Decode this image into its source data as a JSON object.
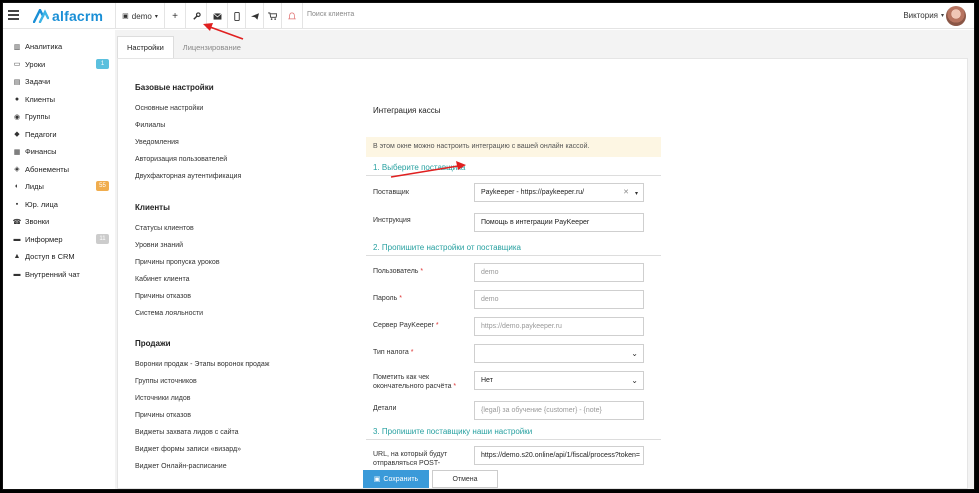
{
  "topbar": {
    "logo_text": "alfacrm",
    "branch": "demo",
    "search_placeholder": "Поиск клиента",
    "user_name": "Виктория",
    "icons": [
      "plus-icon",
      "wrench-icon",
      "mail-icon",
      "phone-icon",
      "telegram-icon",
      "cart-icon",
      "bell-icon"
    ]
  },
  "sidebar": {
    "items": [
      {
        "label": "Аналитика",
        "icon": "analytics-icon"
      },
      {
        "label": "Уроки",
        "icon": "lessons-icon",
        "badge": "1",
        "badge_color": "#5bc0de"
      },
      {
        "label": "Задачи",
        "icon": "tasks-icon"
      },
      {
        "label": "Клиенты",
        "icon": "client-icon"
      },
      {
        "label": "Группы",
        "icon": "groups-icon"
      },
      {
        "label": "Педагоги",
        "icon": "teacher-icon"
      },
      {
        "label": "Финансы",
        "icon": "finance-icon"
      },
      {
        "label": "Абонементы",
        "icon": "subscription-icon"
      },
      {
        "label": "Лиды",
        "icon": "leads-icon",
        "badge": "55",
        "badge_color": "#f0ad4e"
      },
      {
        "label": "Юр. лица",
        "icon": "legal-icon"
      },
      {
        "label": "Звонки",
        "icon": "calls-icon"
      },
      {
        "label": "Информер",
        "icon": "informer-icon",
        "badge": "11",
        "badge_color": "#ccc"
      },
      {
        "label": "Доступ в CRM",
        "icon": "access-icon"
      },
      {
        "label": "Внутренний чат",
        "icon": "chat-icon"
      }
    ]
  },
  "tabs": [
    {
      "label": "Настройки",
      "active": true
    },
    {
      "label": "Лицензирование",
      "active": false
    }
  ],
  "settings_menu": {
    "basic": {
      "title": "Базовые настройки",
      "links": [
        "Основные настройки",
        "Филиалы",
        "Уведомления",
        "Авторизация пользователей",
        "Двухфакторная аутентификация"
      ]
    },
    "clients": {
      "title": "Клиенты",
      "links": [
        "Статусы клиентов",
        "Уровни знаний",
        "Причины пропуска уроков",
        "Кабинет клиента",
        "Причины отказов",
        "Система лояльности"
      ]
    },
    "sales": {
      "title": "Продажи",
      "links": [
        "Воронки продаж - Этапы воронок продаж",
        "Группы источников",
        "Источники лидов",
        "Причины отказов",
        "Виджеты захвата лидов с сайта",
        "Виджет формы записи «визард»",
        "Виджет Онлайн-расписание"
      ]
    }
  },
  "form": {
    "title": "Интеграция кассы",
    "notice": "В этом окне можно настроить интеграцию с вашей онлайн кассой.",
    "step1": "1. Выберите поставщика",
    "step2": "2. Пропишите настройки от поставщика",
    "step3": "3. Пропишите поставщику наши настройки",
    "provider_label": "Поставщик",
    "provider_value": "Paykeeper - https://paykeeper.ru/",
    "instruction_label": "Инструкция",
    "instruction_value": "Помощь в интеграции PayKeeper",
    "user_label": "Пользователь",
    "user_value": "demo",
    "password_label": "Пароль",
    "password_value": "demo",
    "server_label": "Сервер PayKeeper",
    "server_value": "https://demo.paykeeper.ru",
    "tax_label": "Тип налога",
    "tax_value": "",
    "final_label": "Пометить как чек окончательного расчёта",
    "final_value": "Нет",
    "details_label": "Детали",
    "details_value": "{legal} за обучение {customer} - {note}",
    "url_label": "URL, на который будут отправляться POST-запросы",
    "url_value": "https://demo.s20.online/api/1/fiscal/process?token=",
    "required_mark": "*",
    "save_label": "Сохранить",
    "cancel_label": "Отмена"
  }
}
